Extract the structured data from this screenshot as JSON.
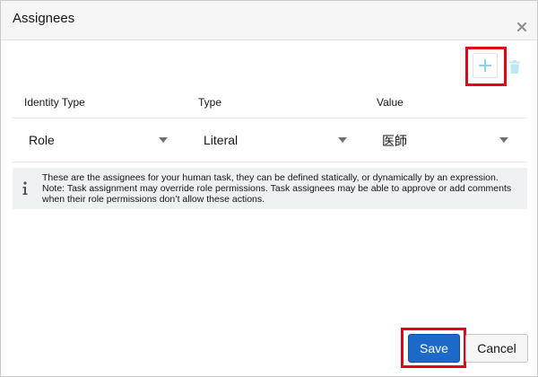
{
  "dialog": {
    "title": "Assignees",
    "close_icon": "close-icon"
  },
  "toolbar": {
    "add_icon": "plus-icon",
    "delete_icon": "trash-icon",
    "highlight_color": "#e0071b"
  },
  "table": {
    "columns": [
      "Identity Type",
      "Type",
      "Value"
    ],
    "rows": [
      {
        "identity_type": "Role",
        "type": "Literal",
        "value": "医師"
      }
    ]
  },
  "info": {
    "icon": "info-icon",
    "message": "These are the assignees for your human task, they can be defined statically, or dynamically by an expression. Note: Task assignment may override role permissions. Task assignees may be able to approve or add comments when their role permissions don’t allow these actions."
  },
  "footer": {
    "save_label": "Save",
    "cancel_label": "Cancel",
    "primary_color": "#1b6ac9"
  }
}
